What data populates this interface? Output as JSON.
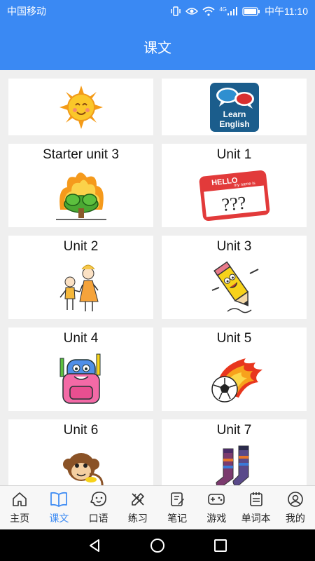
{
  "status_bar": {
    "carrier": "中国移动",
    "network": "4G",
    "time": "中午11:10"
  },
  "header": {
    "title": "课文"
  },
  "cards": [
    {
      "title": "",
      "image": "sun-icon"
    },
    {
      "title": "",
      "image": "learn-english-icon",
      "image_text": [
        "Learn",
        "English"
      ]
    },
    {
      "title": "Starter unit 3",
      "image": "burning-tree-icon"
    },
    {
      "title": "Unit 1",
      "image": "hello-name-tag-icon",
      "image_text": [
        "HELLO",
        "my name is",
        "???"
      ]
    },
    {
      "title": "Unit 2",
      "image": "kids-icon"
    },
    {
      "title": "Unit 3",
      "image": "pencil-character-icon"
    },
    {
      "title": "Unit 4",
      "image": "backpack-icon"
    },
    {
      "title": "Unit 5",
      "image": "flaming-ball-icon"
    },
    {
      "title": "Unit 6",
      "image": "monkey-icon"
    },
    {
      "title": "Unit 7",
      "image": "socks-icon"
    }
  ],
  "tabs": [
    {
      "label": "主页",
      "icon": "home-icon"
    },
    {
      "label": "课文",
      "icon": "book-icon",
      "active": true
    },
    {
      "label": "口语",
      "icon": "face-icon"
    },
    {
      "label": "练习",
      "icon": "pencil-ruler-icon"
    },
    {
      "label": "笔记",
      "icon": "notebook-icon"
    },
    {
      "label": "游戏",
      "icon": "gamepad-icon"
    },
    {
      "label": "单词本",
      "icon": "calendar-icon"
    },
    {
      "label": "我的",
      "icon": "user-icon"
    }
  ],
  "colors": {
    "primary": "#3a89f3",
    "background": "#efefef",
    "card": "#ffffff"
  }
}
